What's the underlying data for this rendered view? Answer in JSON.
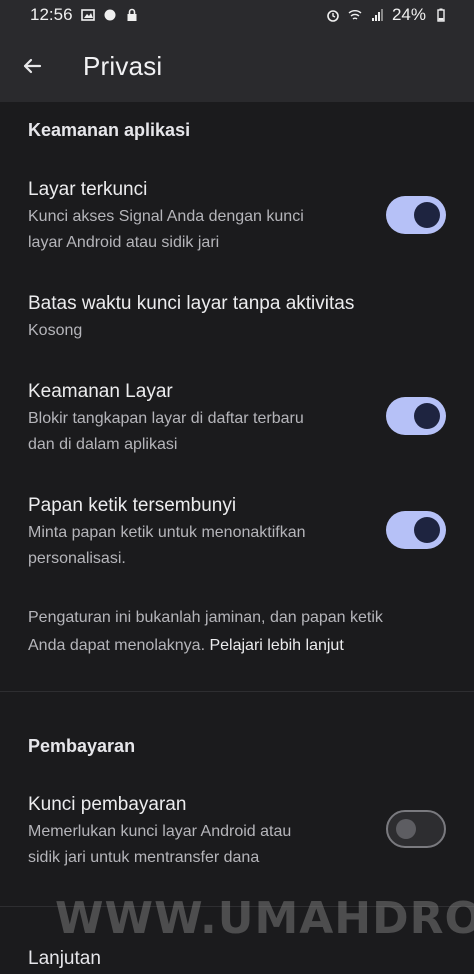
{
  "status_bar": {
    "time": "12:56",
    "battery": "24%"
  },
  "app_bar": {
    "title": "Privasi"
  },
  "sections": {
    "app_security": {
      "header": "Keamanan aplikasi"
    },
    "payments": {
      "header": "Pembayaran"
    },
    "advanced": {
      "header": "Lanjutan"
    }
  },
  "settings": {
    "screen_lock": {
      "title": "Layar terkunci",
      "subtitle_1": "Kunci akses Signal Anda dengan kunci",
      "subtitle_2": "layar Android atau sidik jari",
      "enabled": true
    },
    "inactivity_timeout": {
      "title": "Batas waktu kunci layar tanpa aktivitas",
      "value": "Kosong"
    },
    "screen_security": {
      "title": "Keamanan Layar",
      "subtitle_1": "Blokir tangkapan layar di daftar terbaru",
      "subtitle_2": "dan di dalam aplikasi",
      "enabled": true
    },
    "incognito_keyboard": {
      "title": "Papan ketik tersembunyi",
      "subtitle_1": "Minta papan ketik untuk menonaktifkan",
      "subtitle_2": "personalisasi.",
      "enabled": true
    },
    "keyboard_note": {
      "line_1": "Pengaturan ini bukanlah jaminan, dan papan ketik",
      "line_2_prefix": "Anda dapat menolaknya. ",
      "link": "Pelajari lebih lanjut"
    },
    "payment_lock": {
      "title": "Kunci pembayaran",
      "subtitle_1": "Memerlukan kunci layar Android atau",
      "subtitle_2": "sidik jari untuk mentransfer dana",
      "enabled": false
    }
  },
  "watermark": "WWW.UMAHDROID.COM",
  "colors": {
    "background": "#1b1b1d",
    "toggle_on": "#b6c1f7",
    "toggle_knob_on": "#1e2440"
  }
}
